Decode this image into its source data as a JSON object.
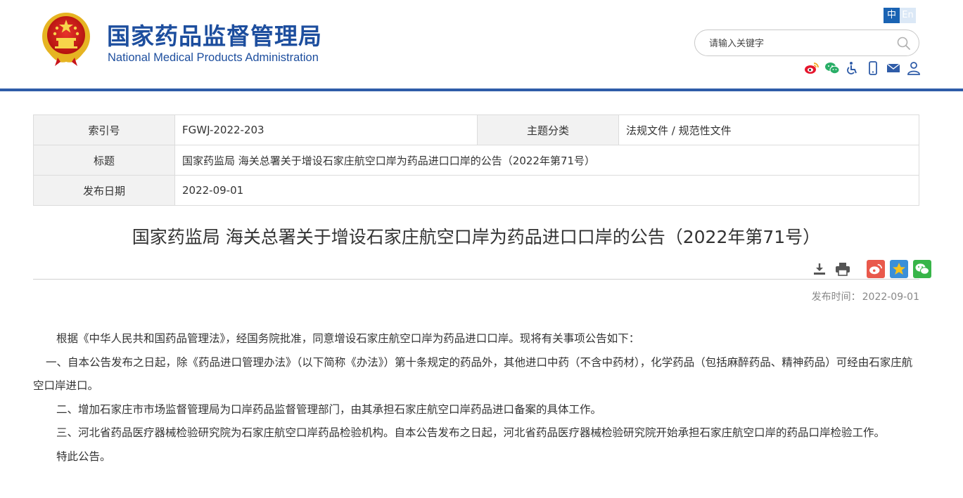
{
  "header": {
    "title_cn": "国家药品监督管理局",
    "title_en": "National Medical Products Administration",
    "lang_cn": "中",
    "lang_en": "En",
    "search_placeholder": "请输入关键字"
  },
  "info": {
    "index_label": "索引号",
    "index_value": "FGWJ-2022-203",
    "category_label": "主题分类",
    "category_value": "法规文件 / 规范性文件",
    "title_label": "标题",
    "title_value": "国家药监局 海关总署关于增设石家庄航空口岸为药品进口口岸的公告（2022年第71号）",
    "date_label": "发布日期",
    "date_value": "2022-09-01"
  },
  "article": {
    "title": "国家药监局 海关总署关于增设石家庄航空口岸为药品进口口岸的公告（2022年第71号）",
    "publish_label": "发布时间：",
    "publish_date": "2022-09-01",
    "paragraphs": [
      "根据《中华人民共和国药品管理法》，经国务院批准，同意增设石家庄航空口岸为药品进口口岸。现将有关事项公告如下：",
      "一、自本公告发布之日起，除《药品进口管理办法》（以下简称《办法》）第十条规定的药品外，其他进口中药（不含中药材），化学药品（包括麻醉药品、精神药品）可经由石家庄航空口岸进口。",
      "二、增加石家庄市市场监督管理局为口岸药品监督管理部门，由其承担石家庄航空口岸药品进口备案的具体工作。",
      "三、河北省药品医疗器械检验研究院为石家庄航空口岸药品检验机构。自本公告发布之日起，河北省药品医疗器械检验研究院开始承担石家庄航空口岸的药品口岸检验工作。",
      "特此公告。"
    ]
  },
  "colors": {
    "brand_blue": "#1d4e9e",
    "header_bar": "#2f5ca8"
  }
}
